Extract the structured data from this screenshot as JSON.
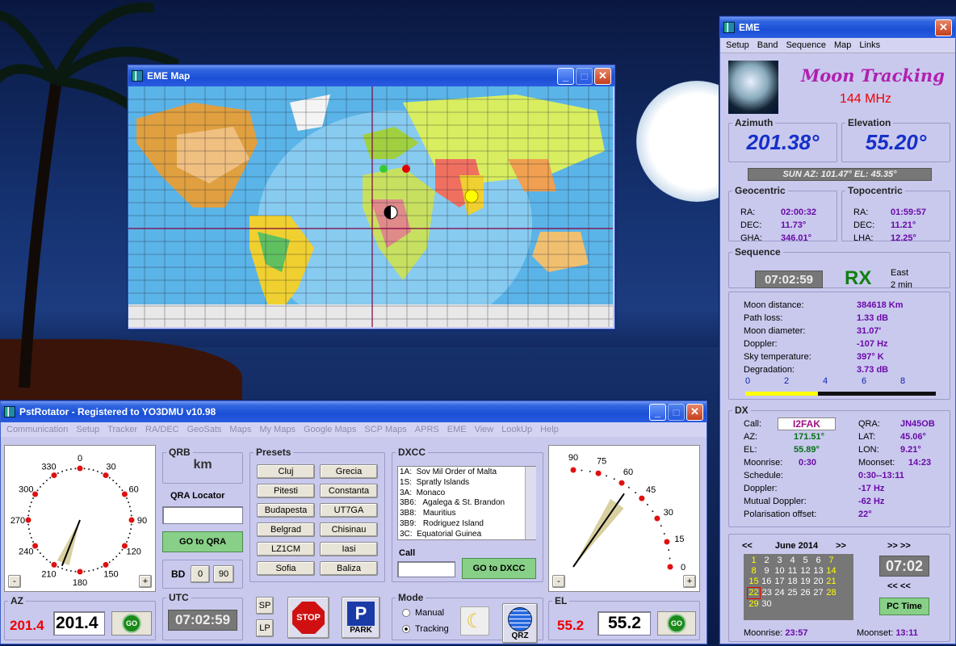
{
  "map_win": {
    "title": "EME Map"
  },
  "eme": {
    "title": "EME",
    "menu": [
      "Setup",
      "Band",
      "Sequence",
      "Map",
      "Links"
    ],
    "heading": "Moon Tracking",
    "band": "144 MHz",
    "azimuth_label": "Azimuth",
    "azimuth": "201.38°",
    "elevation_label": "Elevation",
    "elevation": "55.20°",
    "sun": "SUN  AZ: 101.47°  EL: 45.35°",
    "geo_label": "Geocentric",
    "geo": [
      {
        "k": "RA:",
        "v": "02:00:32"
      },
      {
        "k": "DEC:",
        "v": "11.73°"
      },
      {
        "k": "GHA:",
        "v": "346.01°"
      }
    ],
    "topo_label": "Topocentric",
    "topo": [
      {
        "k": "RA:",
        "v": "01:59:57"
      },
      {
        "k": "DEC:",
        "v": "11.21°"
      },
      {
        "k": "LHA:",
        "v": "12.25°"
      }
    ],
    "seq_label": "Sequence",
    "seq_time": "07:02:59",
    "seq_mode": "RX",
    "seq_dir": "East",
    "seq_dur": "2 min",
    "stats": [
      {
        "k": "Moon distance:",
        "v": "384618 Km"
      },
      {
        "k": "Path loss:",
        "v": "1.33 dB"
      },
      {
        "k": "Moon diameter:",
        "v": "31.07'"
      },
      {
        "k": "Doppler:",
        "v": "-107 Hz"
      },
      {
        "k": "Sky temperature:",
        "v": "397° K"
      },
      {
        "k": "Degradation:",
        "v": "3.73 dB"
      }
    ],
    "scale": [
      "0",
      "2",
      "4",
      "6",
      "8"
    ],
    "degradation_fraction": 0.38,
    "dx_label": "DX",
    "call_label": "Call:",
    "call": "I2FAK",
    "qra_label": "QRA:",
    "qra": "JN45OB",
    "az_label": "AZ:",
    "az": "171.51°",
    "lat_label": "LAT:",
    "lat": "45.06°",
    "el_label": "EL:",
    "el": "55.89°",
    "lon_label": "LON:",
    "lon": "9.21°",
    "moonrise_label": "Moonrise:",
    "moonrise": "0:30",
    "moonset_label": "Moonset:",
    "moonset": "14:23",
    "schedule_label": "Schedule:",
    "schedule": "0:30--13:11",
    "doppler_label": "Doppler:",
    "doppler": "-17 Hz",
    "mdoppler_label": "Mutual Doppler:",
    "mdoppler": "-62 Hz",
    "pol_label": "Polarisation offset:",
    "pol": "22°",
    "cal_prev": "<<",
    "cal_month": "June 2014",
    "cal_next": ">>",
    "cal_rows": [
      [
        "1",
        "2",
        "3",
        "4",
        "5",
        "6",
        "7"
      ],
      [
        "8",
        "9",
        "10",
        "11",
        "12",
        "13",
        "14"
      ],
      [
        "15",
        "16",
        "17",
        "18",
        "19",
        "20",
        "21"
      ],
      [
        "22",
        "23",
        "24",
        "25",
        "26",
        "27",
        "28"
      ],
      [
        "29",
        "30",
        "",
        "",
        "",
        "",
        ""
      ]
    ],
    "time_up": ">>   >>",
    "time": "07:02",
    "time_down": "<<   <<",
    "pctime": "PC Time",
    "moonrise2_label": "Moonrise:",
    "moonrise2": "23:57",
    "moonset2_label": "Moonset:",
    "moonset2": "13:11"
  },
  "rot": {
    "title": "PstRotator - Registered to YO3DMU   v10.98",
    "menu": [
      "Communication",
      "Setup",
      "Tracker",
      "RA/DEC",
      "GeoSats",
      "Maps",
      "My Maps",
      "Google Maps",
      "SCP Maps",
      "APRS",
      "EME",
      "View",
      "LookUp",
      "Help"
    ],
    "compass": [
      "0",
      "30",
      "60",
      "90",
      "120",
      "150",
      "180",
      "210",
      "240",
      "270",
      "300",
      "330"
    ],
    "minus": "-",
    "plus": "+",
    "az_label": "AZ",
    "az_value": "201.4",
    "az_input": "201.4",
    "go": "GO",
    "qrb_label": "QRB",
    "qrb_unit": "km",
    "qra_loc": "QRA Locator",
    "goqra": "GO to QRA",
    "bd_label": "BD",
    "bd0": "0",
    "bd90": "90",
    "utc_label": "UTC",
    "utc": "07:02:59",
    "presets_label": "Presets",
    "presets": [
      "Cluj",
      "Grecia",
      "Pitesti",
      "Constanta",
      "Budapesta",
      "UT7GA",
      "Belgrad",
      "Chisinau",
      "LZ1CM",
      "Iasi",
      "Sofia",
      "Baliza"
    ],
    "sp": "SP",
    "lp": "LP",
    "stop": "STOP",
    "park": "PARK",
    "dxcc_label": "DXCC",
    "dxcc": [
      "1A:  Sov Mil Order of Malta",
      "1S:  Spratly Islands",
      "3A:  Monaco",
      "3B6:   Agalega & St. Brandon",
      "3B8:   Mauritius",
      "3B9:   Rodriguez Island",
      "3C:  Equatorial Guinea"
    ],
    "call_label": "Call",
    "godxcc": "GO to DXCC",
    "mode_label": "Mode",
    "manual": "Manual",
    "tracking": "Tracking",
    "qrz": "QRZ",
    "el_scale": [
      "90",
      "75",
      "60",
      "45",
      "30",
      "15",
      "0"
    ],
    "el_label": "EL",
    "el_value": "55.2",
    "el_input": "55.2"
  }
}
